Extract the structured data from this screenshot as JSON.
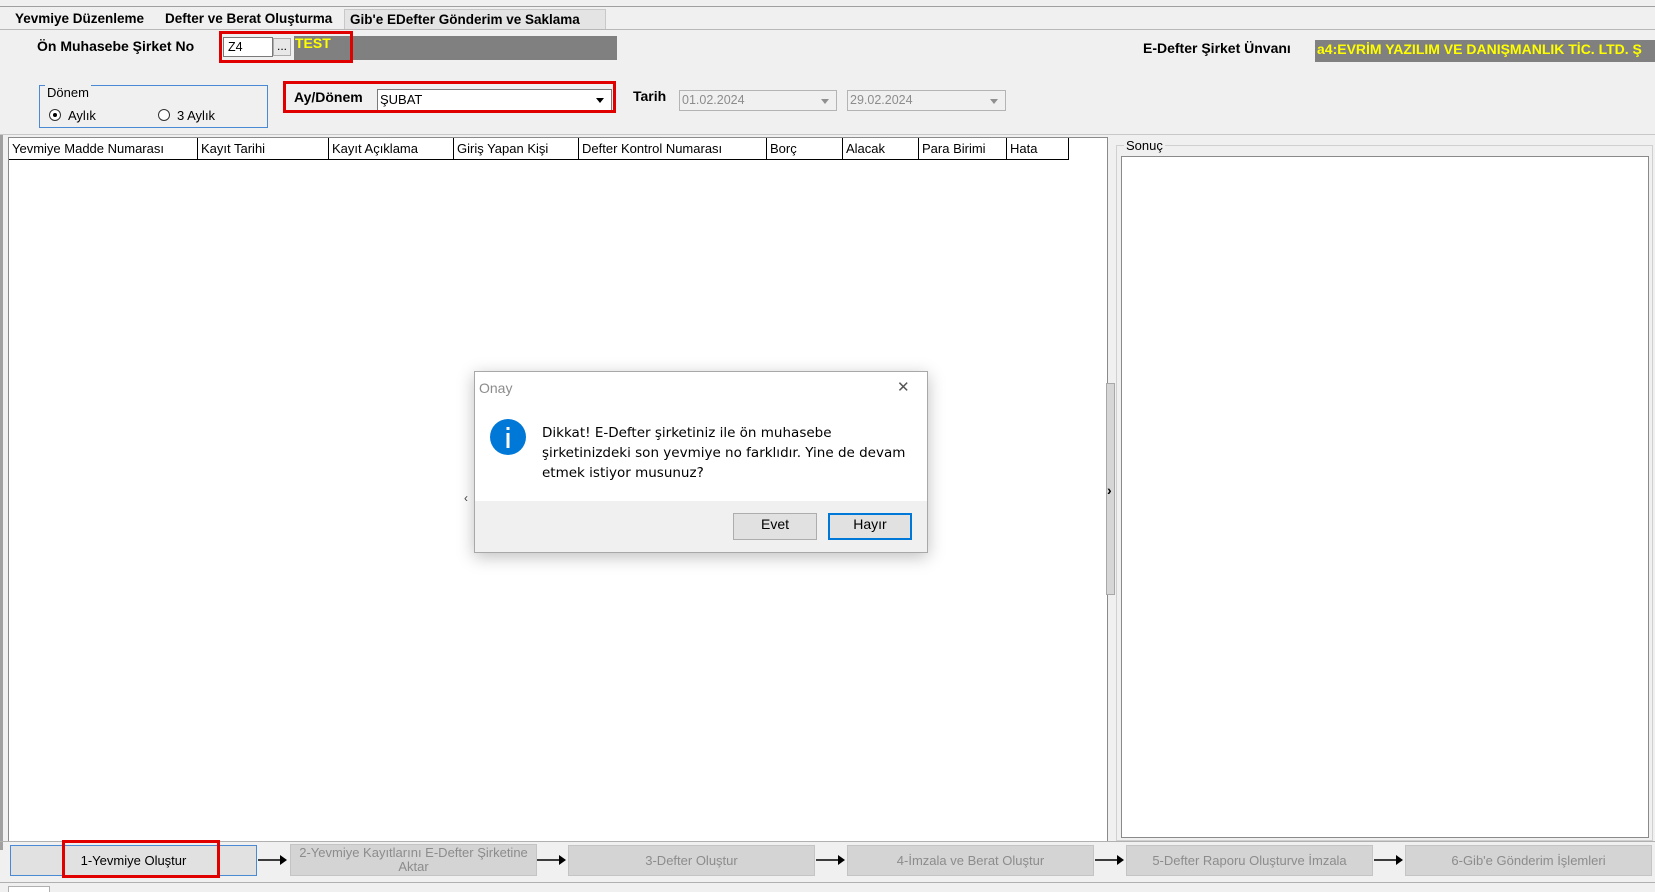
{
  "tabs": [
    {
      "label": "Yevmiye Düzenleme"
    },
    {
      "label": "Defter ve Berat Oluşturma"
    },
    {
      "label": "Gib'e EDefter Gönderim ve Saklama"
    }
  ],
  "company": {
    "label": "Ön Muhasebe Şirket No",
    "value": "Z4",
    "button": "...",
    "name": "TEST"
  },
  "edefter": {
    "label": "E-Defter Şirket Ünvanı",
    "value": "a4:EVRİM YAZILIM VE DANIŞMANLIK TİC. LTD. Ş"
  },
  "period": {
    "group_title": "Dönem",
    "options": [
      {
        "label": "Aylık",
        "selected": true
      },
      {
        "label": "3 Aylık",
        "selected": false
      }
    ]
  },
  "month": {
    "label": "Ay/Dönem",
    "value": "ŞUBAT"
  },
  "date": {
    "label": "Tarih",
    "from": "01.02.2024",
    "to": "29.02.2024"
  },
  "grid": {
    "columns": [
      "Yevmiye Madde Numarası",
      "Kayıt Tarihi",
      "Kayıt Açıklama",
      "Giriş Yapan Kişi",
      "Defter Kontrol Numarası",
      "Borç",
      "Alacak",
      "Para Birimi",
      "Hata"
    ]
  },
  "result": {
    "title": "Sonuç"
  },
  "dialog": {
    "title": "Onay",
    "close": "✕",
    "icon": "info-icon",
    "message": "Dikkat! E-Defter şirketiniz ile ön muhasebe şirketinizdeki son yevmiye no farklıdır. Yine de devam etmek istiyor musunuz?",
    "yes": "Evet",
    "no": "Hayır"
  },
  "steps": [
    {
      "label": "1-Yevmiye Oluştur",
      "enabled": true
    },
    {
      "label": "2-Yevmiye Kayıtlarını E-Defter Şirketine Aktar",
      "enabled": false
    },
    {
      "label": "3-Defter Oluştur",
      "enabled": false
    },
    {
      "label": "4-İmzala ve Berat Oluştur",
      "enabled": false
    },
    {
      "label": "5-Defter Raporu Oluşturve İmzala",
      "enabled": false
    },
    {
      "label": "6-Gib'e Gönderim İşlemleri",
      "enabled": false
    }
  ],
  "colors": {
    "highlight_red": "#e00000",
    "accent_blue": "#0078d7",
    "yellow_text": "#ffff00",
    "gray_bar": "#808080"
  }
}
